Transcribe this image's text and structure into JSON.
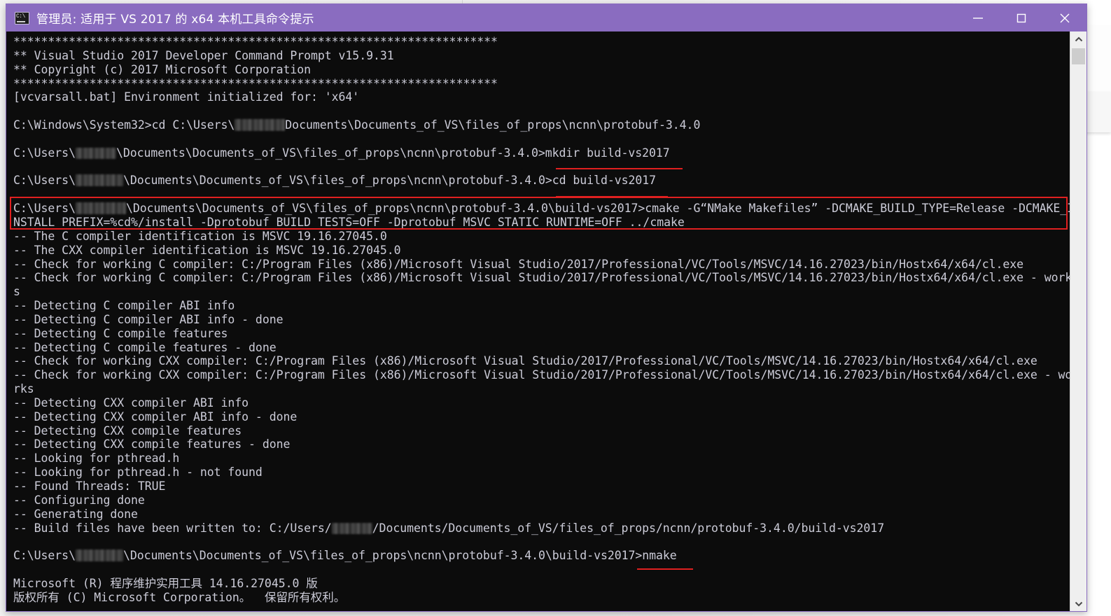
{
  "window": {
    "title": "管理员: 适用于 VS 2017 的 x64 本机工具命令提示",
    "icon": "console-icon",
    "titlebar_color": "#8a6cc0",
    "background_color": "#0c0c0c",
    "text_color": "#ccccd8",
    "controls": {
      "minimize": "minimize-button",
      "maximize": "maximize-button",
      "close": "close-button"
    }
  },
  "annotations": {
    "box_color": "#e02020",
    "underline_color": "#e02020",
    "highlighted_command": "cmake -G\"NMake Makefiles\" -DCMAKE_BUILD_TYPE=Release -DCMAKE_INSTALL_PREFIX=%cd%/install -Dprotobuf_BUILD_TESTS=OFF -Dprotobuf_MSVC_STATIC_RUNTIME=OFF ../cmake",
    "underlined_commands": [
      "mkdir build-vs2017",
      "cd build-vs2017",
      "nmake"
    ]
  },
  "scrollbar": {
    "up_arrow": "scroll-up-arrow",
    "down_arrow": "scroll-down-arrow",
    "thumb": "scroll-thumb"
  },
  "terminal": {
    "lines": [
      "**********************************************************************",
      "** Visual Studio 2017 Developer Command Prompt v15.9.31",
      "** Copyright (c) 2017 Microsoft Corporation",
      "**********************************************************************",
      "[vcvarsall.bat] Environment initialized for: 'x64'",
      "",
      "C:\\Windows\\System32>cd C:\\Users\\@@Documents\\Documents_of_VS\\files_of_props\\ncnn\\protobuf-3.4.0",
      "",
      "C:\\Users\\@@\\Documents\\Documents_of_VS\\files_of_props\\ncnn\\protobuf-3.4.0>mkdir build-vs2017",
      "",
      "C:\\Users\\@@\\Documents\\Documents_of_VS\\files_of_props\\ncnn\\protobuf-3.4.0>cd build-vs2017",
      "",
      "C:\\Users\\@@\\Documents\\Documents_of_VS\\files_of_props\\ncnn\\protobuf-3.4.0\\build-vs2017>cmake -G“NMake Makefiles” -DCMAKE_BUILD_TYPE=Release -DCMAKE_I",
      "NSTALL_PREFIX=%cd%/install -Dprotobuf_BUILD_TESTS=OFF -Dprotobuf_MSVC_STATIC_RUNTIME=OFF ../cmake",
      "-- The C compiler identification is MSVC 19.16.27045.0",
      "-- The CXX compiler identification is MSVC 19.16.27045.0",
      "-- Check for working C compiler: C:/Program Files (x86)/Microsoft Visual Studio/2017/Professional/VC/Tools/MSVC/14.16.27023/bin/Hostx64/x64/cl.exe",
      "-- Check for working C compiler: C:/Program Files (x86)/Microsoft Visual Studio/2017/Professional/VC/Tools/MSVC/14.16.27023/bin/Hostx64/x64/cl.exe - work",
      "s",
      "-- Detecting C compiler ABI info",
      "-- Detecting C compiler ABI info - done",
      "-- Detecting C compile features",
      "-- Detecting C compile features - done",
      "-- Check for working CXX compiler: C:/Program Files (x86)/Microsoft Visual Studio/2017/Professional/VC/Tools/MSVC/14.16.27023/bin/Hostx64/x64/cl.exe",
      "-- Check for working CXX compiler: C:/Program Files (x86)/Microsoft Visual Studio/2017/Professional/VC/Tools/MSVC/14.16.27023/bin/Hostx64/x64/cl.exe - wo",
      "rks",
      "-- Detecting CXX compiler ABI info",
      "-- Detecting CXX compiler ABI info - done",
      "-- Detecting CXX compile features",
      "-- Detecting CXX compile features - done",
      "-- Looking for pthread.h",
      "-- Looking for pthread.h - not found",
      "-- Found Threads: TRUE",
      "-- Configuring done",
      "-- Generating done",
      "-- Build files have been written to: C:/Users/@@/Documents/Documents_of_VS/files_of_props/ncnn/protobuf-3.4.0/build-vs2017",
      "",
      "C:\\Users\\@@\\Documents\\Documents_of_VS\\files_of_props\\ncnn\\protobuf-3.4.0\\build-vs2017>nmake",
      "",
      "Microsoft (R) 程序维护实用工具 14.16.27045.0 版",
      "版权所有 (C) Microsoft Corporation。  保留所有权利。"
    ]
  }
}
